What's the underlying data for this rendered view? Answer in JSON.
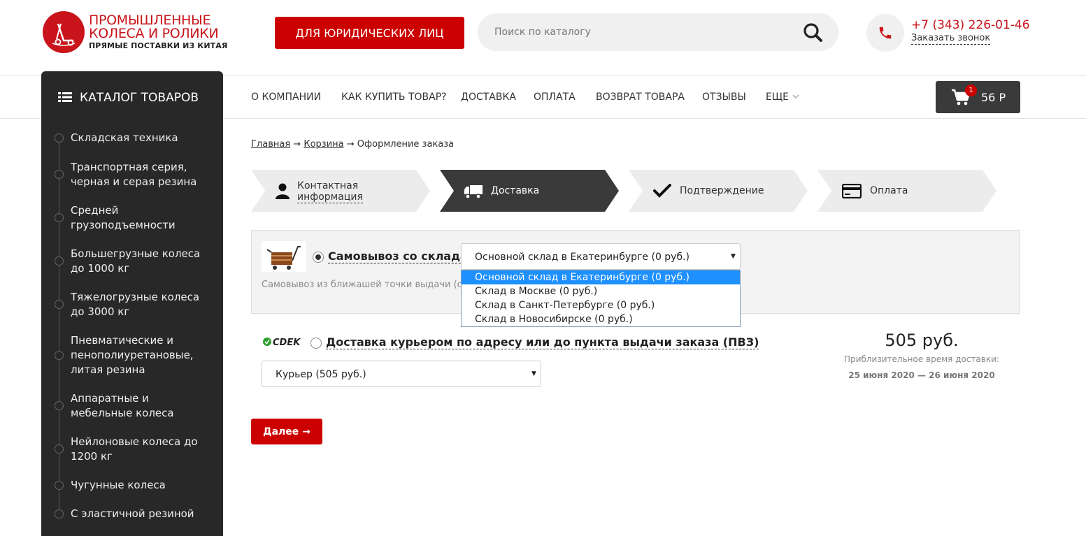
{
  "header": {
    "logo": {
      "line1": "ПРОМЫШЛЕННЫЕ",
      "line2": "КОЛЕСА И РОЛИКИ",
      "line3": "ПРЯМЫЕ ПОСТАВКИ ИЗ КИТАЯ"
    },
    "legal_button": "ДЛЯ ЮРИДИЧЕСКИХ ЛИЦ",
    "search": {
      "placeholder": "Поиск по каталогу",
      "value": ""
    },
    "phone": "+7 (343) 226-01-46",
    "callback_link": "Заказать звонок"
  },
  "sidebar": {
    "title": "КАТАЛОГ ТОВАРОВ",
    "items": [
      {
        "label": "Складская техника"
      },
      {
        "label": "Транспортная серия, черная и серая резина"
      },
      {
        "label": "Средней грузоподъемности"
      },
      {
        "label": "Большегрузные колеса до 1000 кг"
      },
      {
        "label": "Тяжелогрузные колеса до 3000 кг"
      },
      {
        "label": "Пневматические и пенополиуретановые, литая резина"
      },
      {
        "label": "Аппаратные и мебельные колеса"
      },
      {
        "label": "Нейлоновые колеса до 1200 кг"
      },
      {
        "label": "Чугунные колеса"
      },
      {
        "label": "С эластичной резиной"
      }
    ]
  },
  "nav": {
    "items": [
      "О КОМПАНИИ",
      "КАК КУПИТЬ ТОВАР?",
      "ДОСТАВКА",
      "ОПЛАТА",
      "ВОЗВРАТ ТОВАРА",
      "ОТЗЫВЫ",
      "ЕЩЕ"
    ],
    "cart": {
      "count": "1",
      "total": "56 Р"
    }
  },
  "breadcrumb": {
    "home": "Главная",
    "cart": "Корзина",
    "current": "Оформление заказа",
    "separator": "→"
  },
  "steps": [
    {
      "label": "Контактная информация",
      "line1": "Контактная",
      "line2": "информация",
      "icon": "person-icon",
      "active": false
    },
    {
      "label": "Доставка",
      "icon": "truck-icon",
      "active": true
    },
    {
      "label": "Подтверждение",
      "icon": "check-icon",
      "active": false
    },
    {
      "label": "Оплата",
      "icon": "card-icon",
      "active": false
    }
  ],
  "pickup": {
    "label": "Самовывоз со склада",
    "selected": true,
    "description": "Самовывоз из ближашей точки выдачи (спис",
    "select_value": "Основной склад в Екатеринбурге (0 руб.)",
    "options": [
      "Основной склад в Екатеринбурге (0 руб.)",
      "Склад в Москве (0 руб.)",
      "Склад в Санкт-Петербурге (0 руб.)",
      "Склад в Новосибирске (0 руб.)"
    ],
    "highlighted_option": 0
  },
  "courier": {
    "logo_text": "CDEK",
    "label": "Доставка курьером по адресу или до пункта выдачи заказа (ПВЗ)",
    "selected": false,
    "select_value": "Курьер (505 руб.)",
    "price": "505 руб.",
    "eta_label": "Приблизительное время доставки:",
    "eta_dates": "25 июня 2020 — 26 июня 2020"
  },
  "next_button": "Далее →",
  "colors": {
    "brand_red": "#c8141a",
    "dark": "#282828",
    "step_active": "#3a3a3a",
    "step_inactive": "#ececec",
    "highlight": "#1e90ff"
  }
}
